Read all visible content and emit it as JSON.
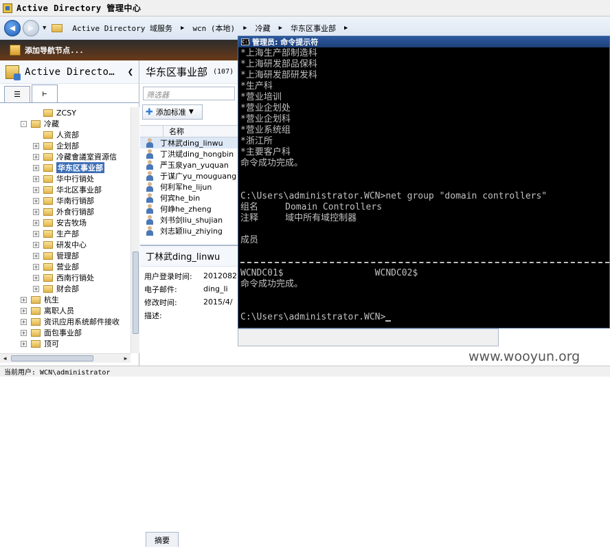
{
  "window": {
    "title": "Active Directory 管理中心"
  },
  "nav": {
    "breadcrumb": [
      "Active Directory 域服务",
      "wcn (本地)",
      "冷藏",
      "华东区事业部"
    ]
  },
  "action": {
    "add_nav_node": "添加导航节点..."
  },
  "left": {
    "title": "Active Directo…",
    "tree": [
      {
        "label": "ZCSY",
        "expander": "",
        "level": 2
      },
      {
        "label": "冷藏",
        "expander": "-",
        "level": 1
      },
      {
        "label": "人资部",
        "expander": "",
        "level": 2
      },
      {
        "label": "企划部",
        "expander": "+",
        "level": 2
      },
      {
        "label": "冷藏會議室資源信",
        "expander": "+",
        "level": 2
      },
      {
        "label": "华东区事业部",
        "expander": "+",
        "level": 2,
        "selected": true
      },
      {
        "label": "华中行销处",
        "expander": "+",
        "level": 2
      },
      {
        "label": "华北区事业部",
        "expander": "+",
        "level": 2
      },
      {
        "label": "华南行销部",
        "expander": "+",
        "level": 2
      },
      {
        "label": "外食行销部",
        "expander": "+",
        "level": 2
      },
      {
        "label": "安吉牧场",
        "expander": "+",
        "level": 2
      },
      {
        "label": "生产部",
        "expander": "+",
        "level": 2
      },
      {
        "label": "研发中心",
        "expander": "+",
        "level": 2
      },
      {
        "label": "管理部",
        "expander": "+",
        "level": 2
      },
      {
        "label": "营业部",
        "expander": "+",
        "level": 2
      },
      {
        "label": "西南行销处",
        "expander": "+",
        "level": 2
      },
      {
        "label": "财会部",
        "expander": "+",
        "level": 2
      },
      {
        "label": "杭生",
        "expander": "+",
        "level": 1
      },
      {
        "label": "离职人员",
        "expander": "+",
        "level": 1
      },
      {
        "label": "资讯应用系统邮件接收",
        "expander": "+",
        "level": 1
      },
      {
        "label": "面包事业部",
        "expander": "+",
        "level": 1
      },
      {
        "label": "顶可",
        "expander": "+",
        "level": 1
      }
    ]
  },
  "middle": {
    "title": "华东区事业部",
    "count": "(107)",
    "filter_placeholder": "筛选器",
    "add_criteria": "添加标准",
    "column_name": "名称",
    "users": [
      "丁林武ding_linwu",
      "丁洪斌ding_hongbin",
      "严玉泉yan_yuquan",
      "于谋广yu_mouguang",
      "何利军he_lijun",
      "何宾he_bin",
      "何峥he_zheng",
      "刘书剑liu_shujian",
      "刘志颖liu_zhiying"
    ],
    "details": {
      "title": "丁林武ding_linwu",
      "rows": [
        {
          "label": "用户登录时间:",
          "value": "2012082"
        },
        {
          "label": "电子邮件:",
          "value": "ding_li"
        },
        {
          "label": "修改时间:",
          "value": "2015/4/"
        },
        {
          "label": "描述:",
          "value": ""
        }
      ]
    },
    "summary_tab": "摘要"
  },
  "cmd": {
    "title": "管理员: 命令提示符",
    "icon_text": "C:\\",
    "lines": [
      "*上海生产部制造科",
      "*上海研发部品保科",
      "*上海研发部研发科",
      "*生产科",
      "*营业培训",
      "*营业企划处",
      "*营业企划科",
      "*营业系统组",
      "*浙江所",
      "*主要客户科",
      "命令成功完成。",
      "",
      "",
      "C:\\Users\\administrator.WCN>net group \"domain controllers\"",
      "组名     Domain Controllers",
      "注释     域中所有域控制器",
      "",
      "成员",
      "",
      "---",
      "WCNDC01$                 WCNDC02$",
      "命令成功完成。",
      "",
      "",
      "C:\\Users\\administrator.WCN>"
    ]
  },
  "status": {
    "current_user": "当前用户: WCN\\administrator"
  },
  "watermark": "www.wooyun.org"
}
